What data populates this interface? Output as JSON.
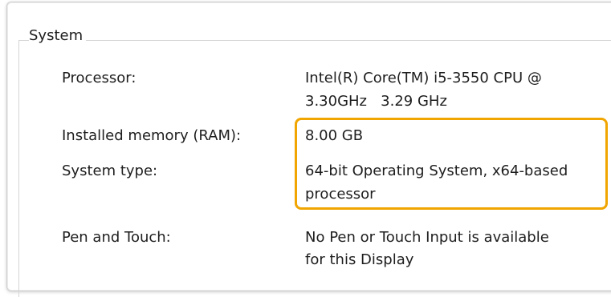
{
  "system": {
    "group_label": "System",
    "rows": [
      {
        "label": "Processor:",
        "value_lines": [
          "Intel(R) Core(TM) i5-3550 CPU @",
          "3.30GHz   3.29 GHz"
        ]
      },
      {
        "label": "Installed memory (RAM):",
        "value_lines": [
          "8.00 GB"
        ]
      },
      {
        "label": "System type:",
        "value_lines": [
          "64-bit Operating System, x64-based",
          "processor"
        ]
      },
      {
        "label": "Pen and Touch:",
        "value_lines": [
          "No Pen or Touch Input is available",
          "for this Display"
        ]
      }
    ]
  },
  "highlight": {
    "color": "#f0a500"
  }
}
